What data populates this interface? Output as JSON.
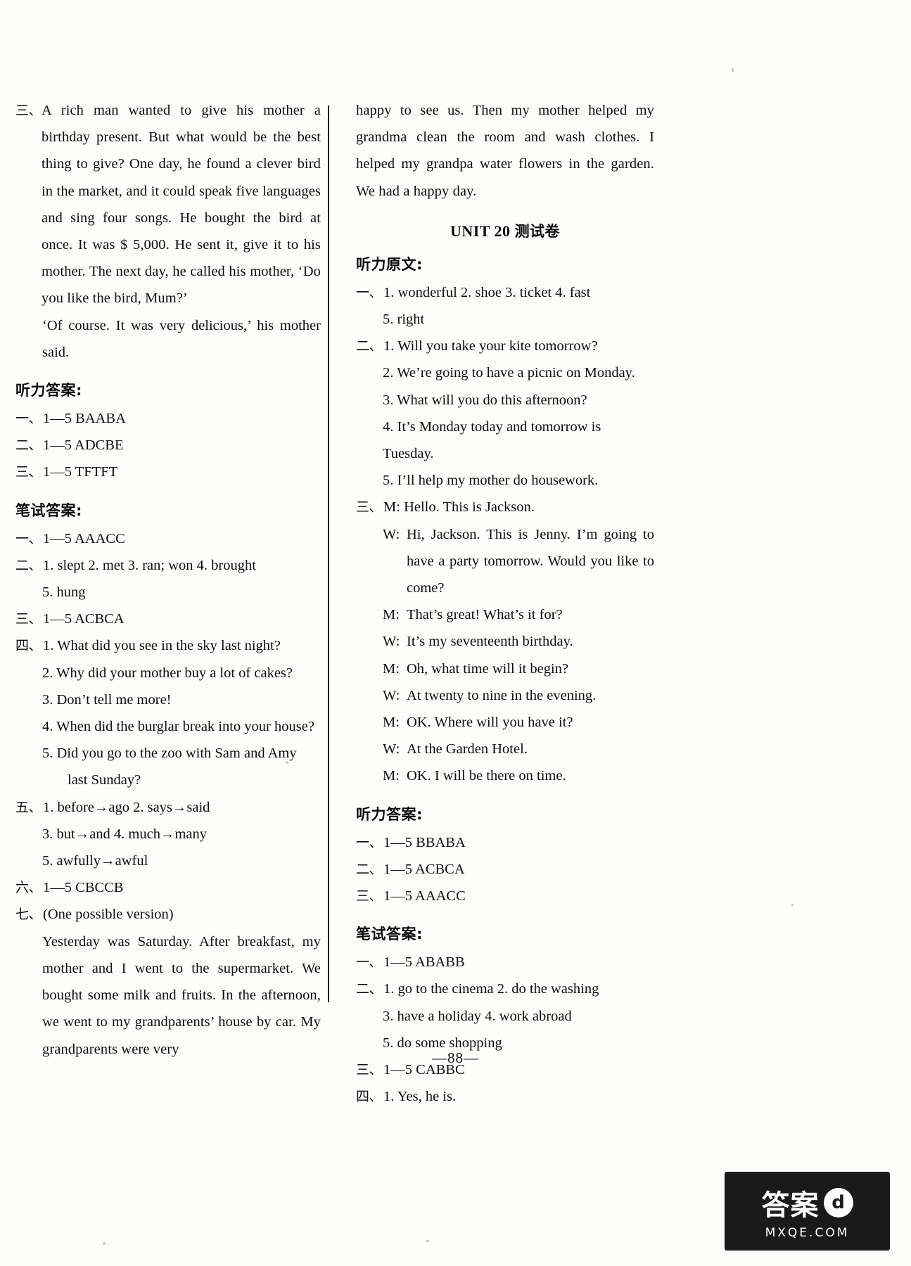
{
  "page": {
    "number": "—88—",
    "watermark": {
      "main": "答案",
      "badge": "d",
      "sub": "MXQE.COM"
    }
  },
  "left_column": {
    "reading_passage": {
      "marker": "三、",
      "text": "A rich man wanted to give his mother a birthday present. But what would be the best thing to give? One day, he found a clever bird in the market, and it could speak five languages and sing four songs. He bought the bird at once. It was $ 5,000. He sent it, give it to his mother. The next day, he called his mother, ‘Do you like the bird, Mum?’",
      "continuation": "‘Of course. It was very delicious,’ his mother said."
    },
    "listening_answers": {
      "heading": "听力答案:",
      "items": [
        {
          "marker": "一、",
          "text": "1—5 BAABA"
        },
        {
          "marker": "二、",
          "text": "1—5 ADCBE"
        },
        {
          "marker": "三、",
          "text": "1—5 TFTFT"
        }
      ]
    },
    "written_answers": {
      "heading": "笔试答案:",
      "item1": {
        "marker": "一、",
        "text": "1—5 AAACC"
      },
      "item2": {
        "marker": "二、",
        "line1": "1. slept    2. met    3. ran; won    4. brought",
        "line2": "5. hung"
      },
      "item3": {
        "marker": "三、",
        "text": "1—5 ACBCA"
      },
      "item4": {
        "marker": "四、",
        "lines": [
          "1. What did you see in the sky last night?",
          "2. Why did your mother buy a lot of cakes?",
          "3. Don’t tell me more!",
          "4. When did the burglar break into your house?",
          "5. Did you go to the zoo with Sam and Amy",
          "last Sunday?"
        ]
      },
      "item5": {
        "marker": "五、",
        "lines": [
          "1. before→ago    2. says→said",
          "3. but→and    4. much→many",
          "5. awfully→awful"
        ]
      },
      "item6": {
        "marker": "六、",
        "text": "1—5 CBCCB"
      },
      "item7": {
        "marker": "七、",
        "note": "(One possible version)",
        "essay": "Yesterday was Saturday. After breakfast, my mother and I went to the supermarket. We bought some milk and fruits. In the afternoon, we went to my grandparents’ house by car. My grandparents were very"
      }
    }
  },
  "right_column": {
    "essay_continuation": "happy to see us. Then my mother helped my grandma clean the room and wash clothes. I helped my grandpa water flowers in the garden. We had a happy day.",
    "unit_title": {
      "en": "UNIT 20",
      "cn": "测试卷"
    },
    "listening_script": {
      "heading": "听力原文:",
      "part1": {
        "marker": "一、",
        "line1": "1. wonderful    2. shoe    3. ticket    4. fast",
        "line2": "5. right"
      },
      "part2": {
        "marker": "二、",
        "lines": [
          "1. Will you take your kite tomorrow?",
          "2. We’re going to have a picnic on Monday.",
          "3. What will you do this afternoon?",
          "4. It’s Monday today and tomorrow is Tuesday.",
          "5. I’ll help my mother do housework."
        ]
      },
      "part3": {
        "marker": "三、",
        "dialogue": [
          {
            "speaker": "M:",
            "text": "Hello. This is Jackson."
          },
          {
            "speaker": "W:",
            "text": "Hi, Jackson. This is Jenny. I’m going to have a party tomorrow. Would you like to come?"
          },
          {
            "speaker": "M:",
            "text": "That’s great! What’s it for?"
          },
          {
            "speaker": "W:",
            "text": "It’s my seventeenth birthday."
          },
          {
            "speaker": "M:",
            "text": "Oh, what time will it begin?"
          },
          {
            "speaker": "W:",
            "text": "At twenty to nine in the evening."
          },
          {
            "speaker": "M:",
            "text": "OK. Where will you have it?"
          },
          {
            "speaker": "W:",
            "text": "At the Garden Hotel."
          },
          {
            "speaker": "M:",
            "text": "OK. I will be there on time."
          }
        ]
      }
    },
    "listening_answers": {
      "heading": "听力答案:",
      "items": [
        {
          "marker": "一、",
          "text": "1—5 BBABA"
        },
        {
          "marker": "二、",
          "text": "1—5 ACBCA"
        },
        {
          "marker": "三、",
          "text": "1—5 AAACC"
        }
      ]
    },
    "written_answers": {
      "heading": "笔试答案:",
      "item1": {
        "marker": "一、",
        "text": "1—5 ABABB"
      },
      "item2": {
        "marker": "二、",
        "line1": "1. go to the cinema    2. do the washing",
        "line2": "3. have a holiday    4. work abroad",
        "line3": "5. do some shopping"
      },
      "item3": {
        "marker": "三、",
        "text": "1—5 CABBC"
      },
      "item4": {
        "marker": "四、",
        "text": "1. Yes, he is."
      }
    }
  }
}
